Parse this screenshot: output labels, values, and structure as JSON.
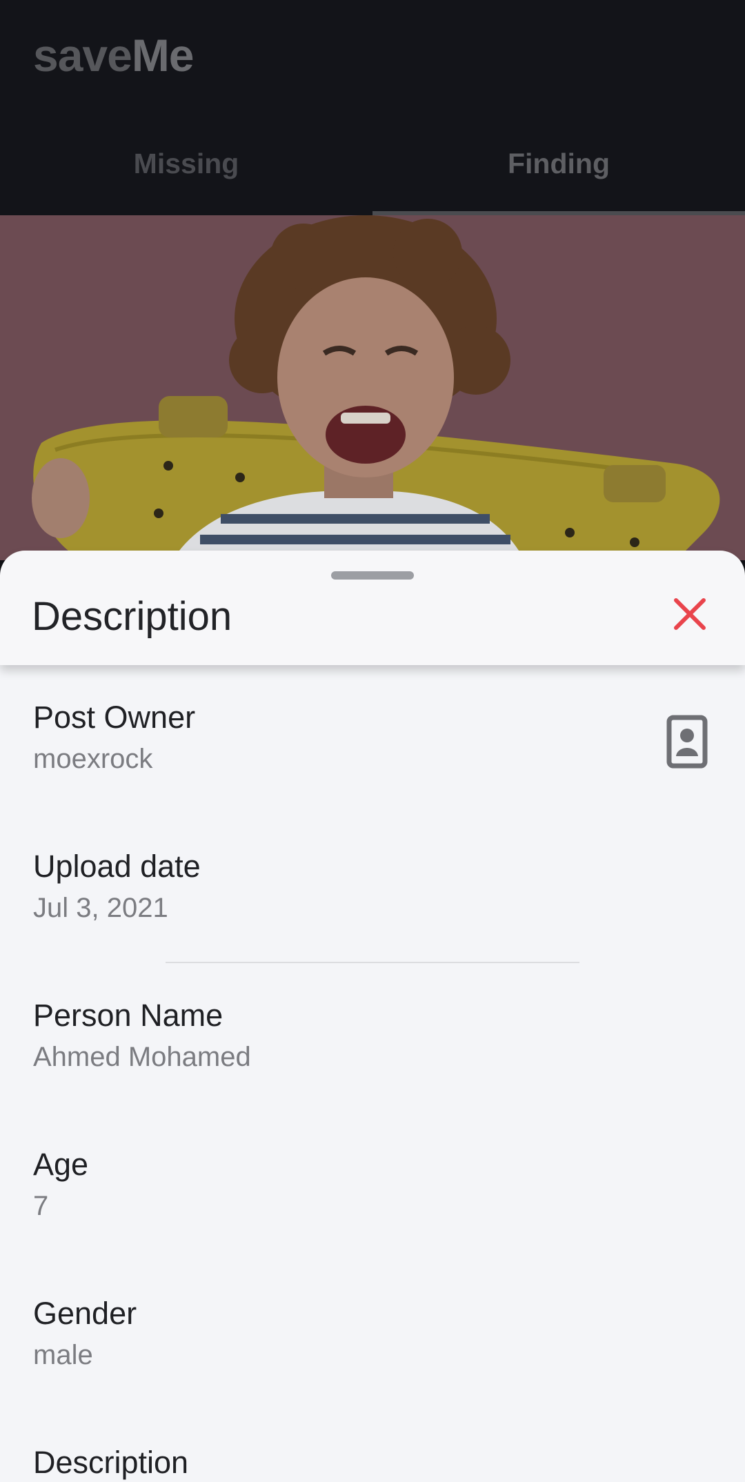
{
  "app": {
    "title_part1": "save",
    "title_part2": "Me"
  },
  "tabs": [
    {
      "label": "Missing",
      "active": false
    },
    {
      "label": "Finding",
      "active": true
    }
  ],
  "sheet": {
    "title": "Description",
    "close_icon": "close-icon",
    "accent_close_color": "#e9444c"
  },
  "details": {
    "post_owner": {
      "label": "Post Owner",
      "value": "moexrock",
      "icon": "contact-card-icon"
    },
    "upload_date": {
      "label": "Upload date",
      "value": "Jul 3, 2021"
    },
    "person_name": {
      "label": "Person Name",
      "value": "Ahmed Mohamed"
    },
    "age": {
      "label": "Age",
      "value": "7"
    },
    "gender": {
      "label": "Gender",
      "value": "male"
    },
    "description": {
      "label": "Description"
    }
  }
}
